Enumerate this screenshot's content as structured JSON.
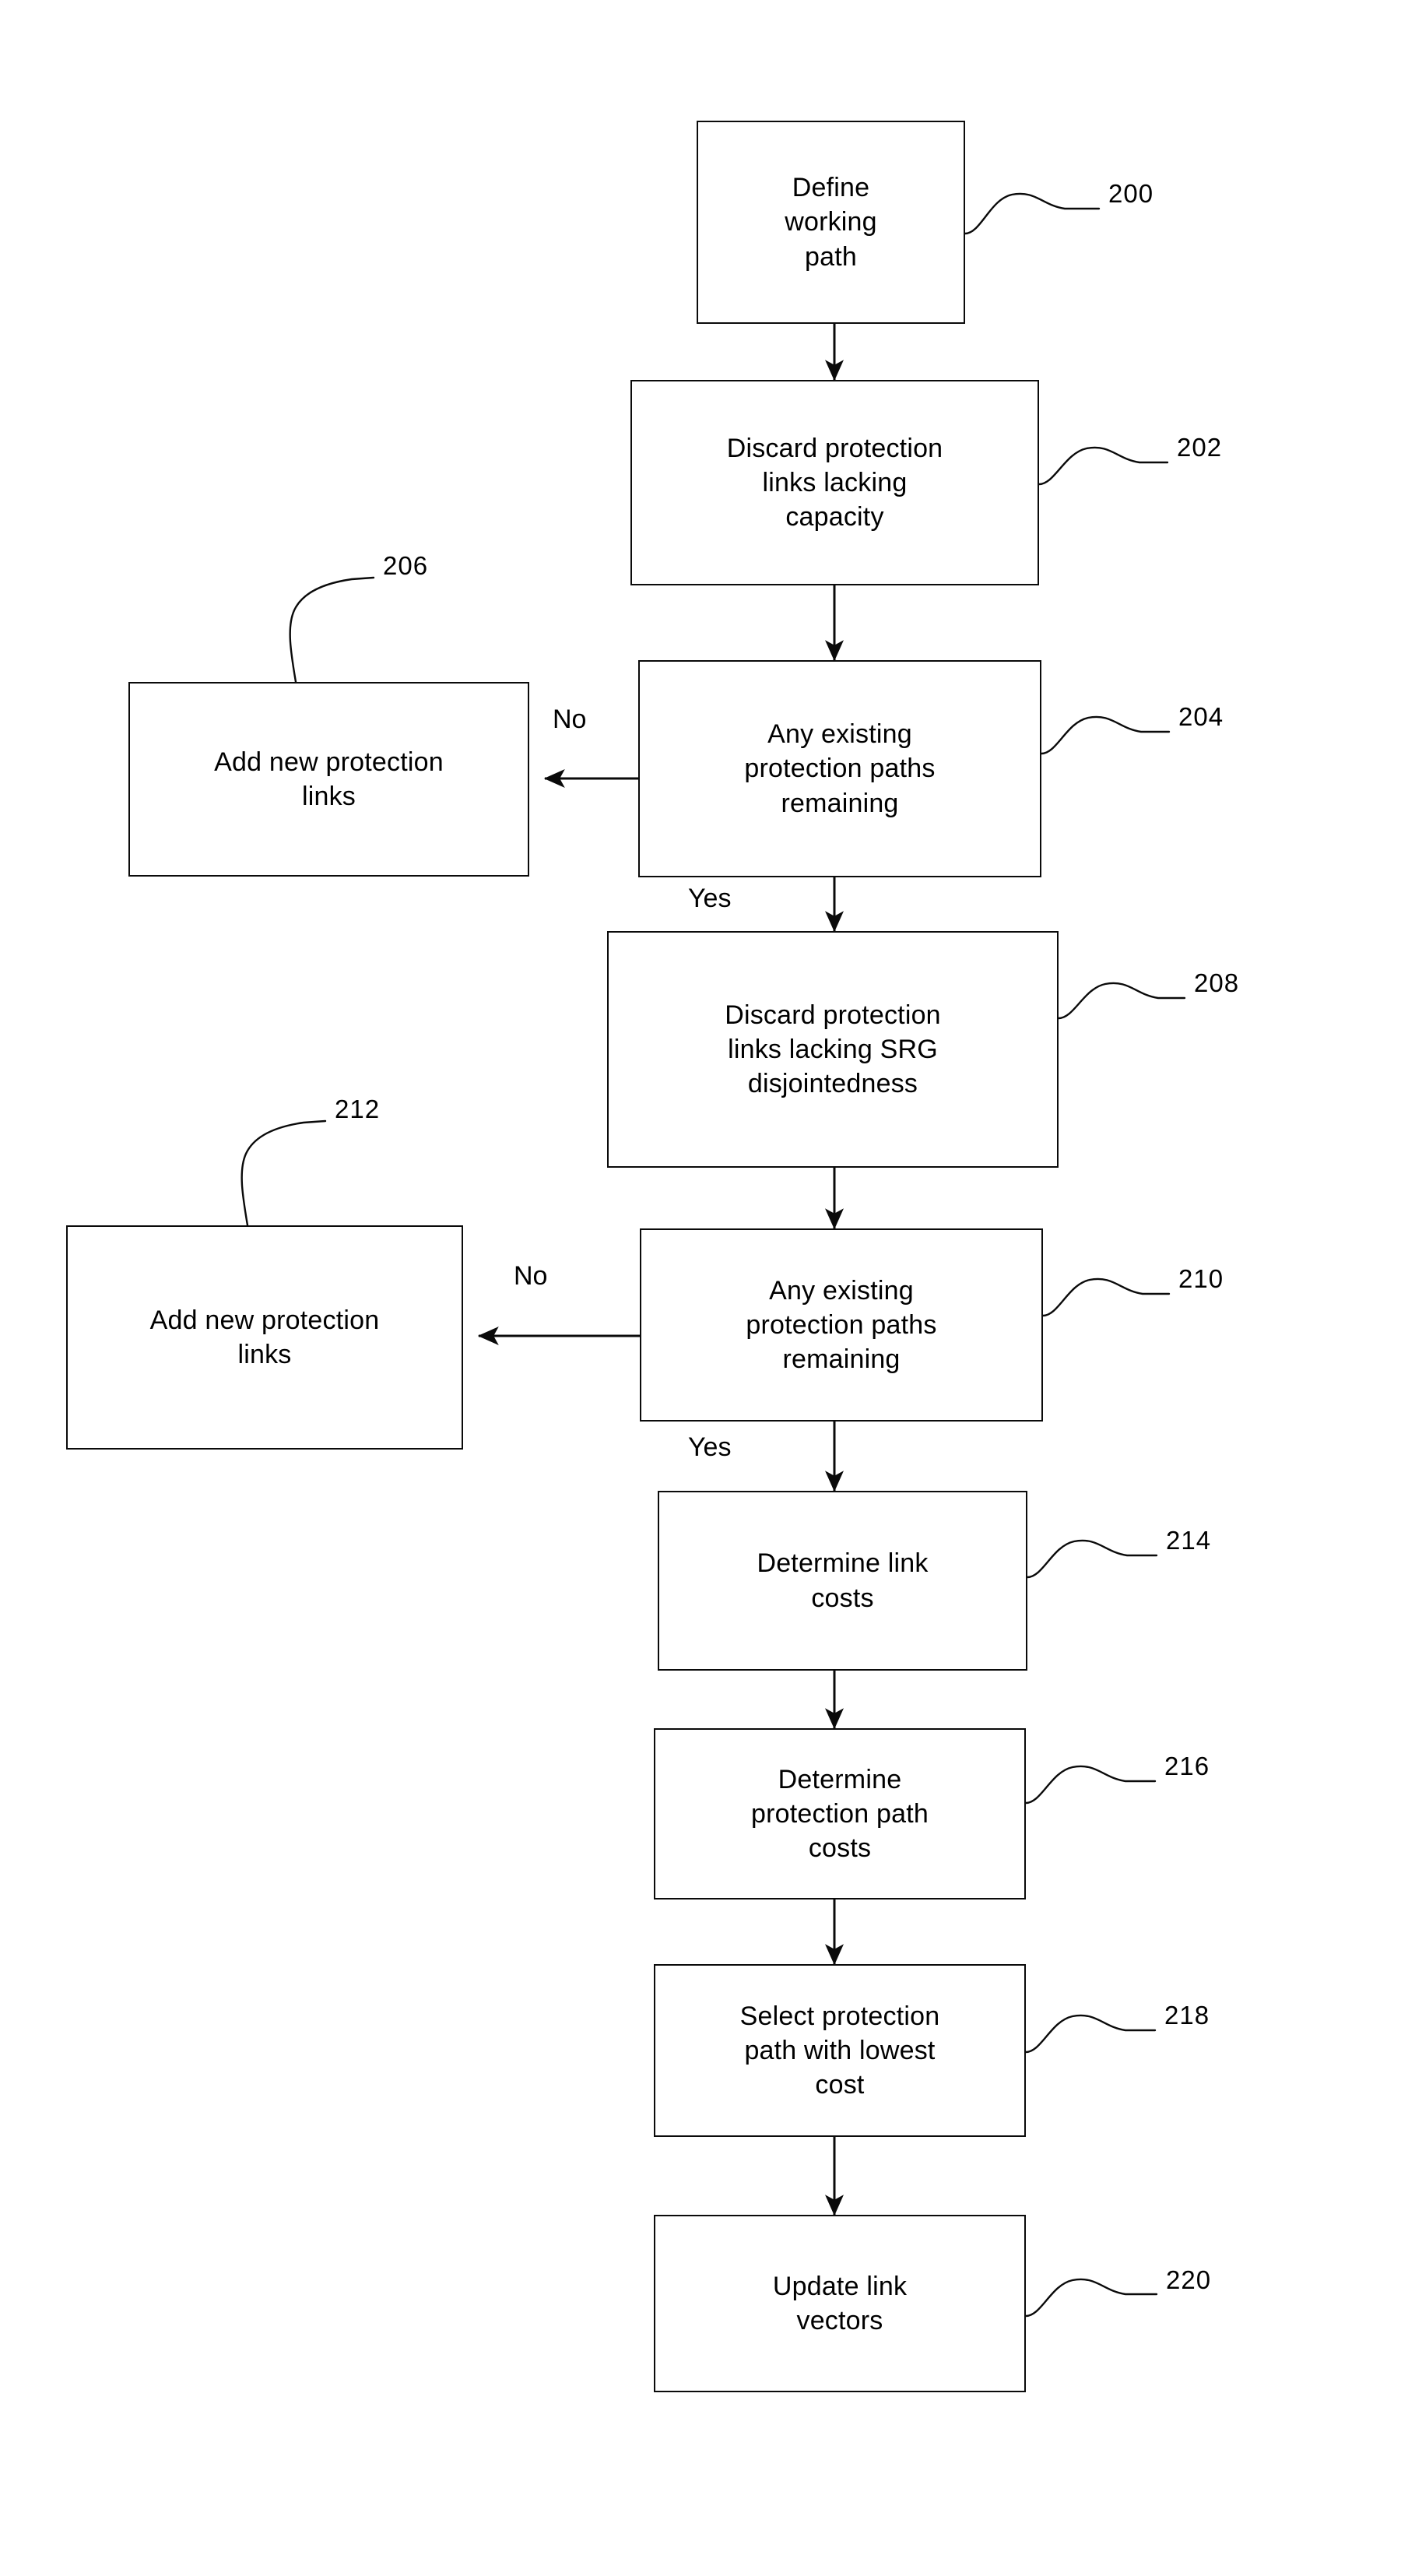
{
  "figure": {
    "type": "patent-flowchart",
    "title": "",
    "nodes": [
      {
        "id": "n200",
        "ref": "200",
        "text": "Define\nworking\npath",
        "shape": "process"
      },
      {
        "id": "n202",
        "ref": "202",
        "text": "Discard protection\nlinks lacking\ncapacity",
        "shape": "process"
      },
      {
        "id": "n204",
        "ref": "204",
        "text": "Any existing\nprotection paths\nremaining",
        "shape": "decision"
      },
      {
        "id": "n206",
        "ref": "206",
        "text": "Add new protection\nlinks",
        "shape": "process"
      },
      {
        "id": "n208",
        "ref": "208",
        "text": "Discard protection\nlinks lacking SRG\ndisjointedness",
        "shape": "process"
      },
      {
        "id": "n210",
        "ref": "210",
        "text": "Any existing\nprotection paths\nremaining",
        "shape": "decision"
      },
      {
        "id": "n212",
        "ref": "212",
        "text": "Add new protection\nlinks",
        "shape": "process"
      },
      {
        "id": "n214",
        "ref": "214",
        "text": "Determine link\ncosts",
        "shape": "process"
      },
      {
        "id": "n216",
        "ref": "216",
        "text": "Determine\nprotection path\ncosts",
        "shape": "process"
      },
      {
        "id": "n218",
        "ref": "218",
        "text": "Select protection\npath with lowest\ncost",
        "shape": "process"
      },
      {
        "id": "n220",
        "ref": "220",
        "text": "Update link\nvectors",
        "shape": "process"
      }
    ],
    "edge_labels": {
      "no_204": "No",
      "yes_204": "Yes",
      "no_210": "No",
      "yes_210": "Yes"
    }
  }
}
